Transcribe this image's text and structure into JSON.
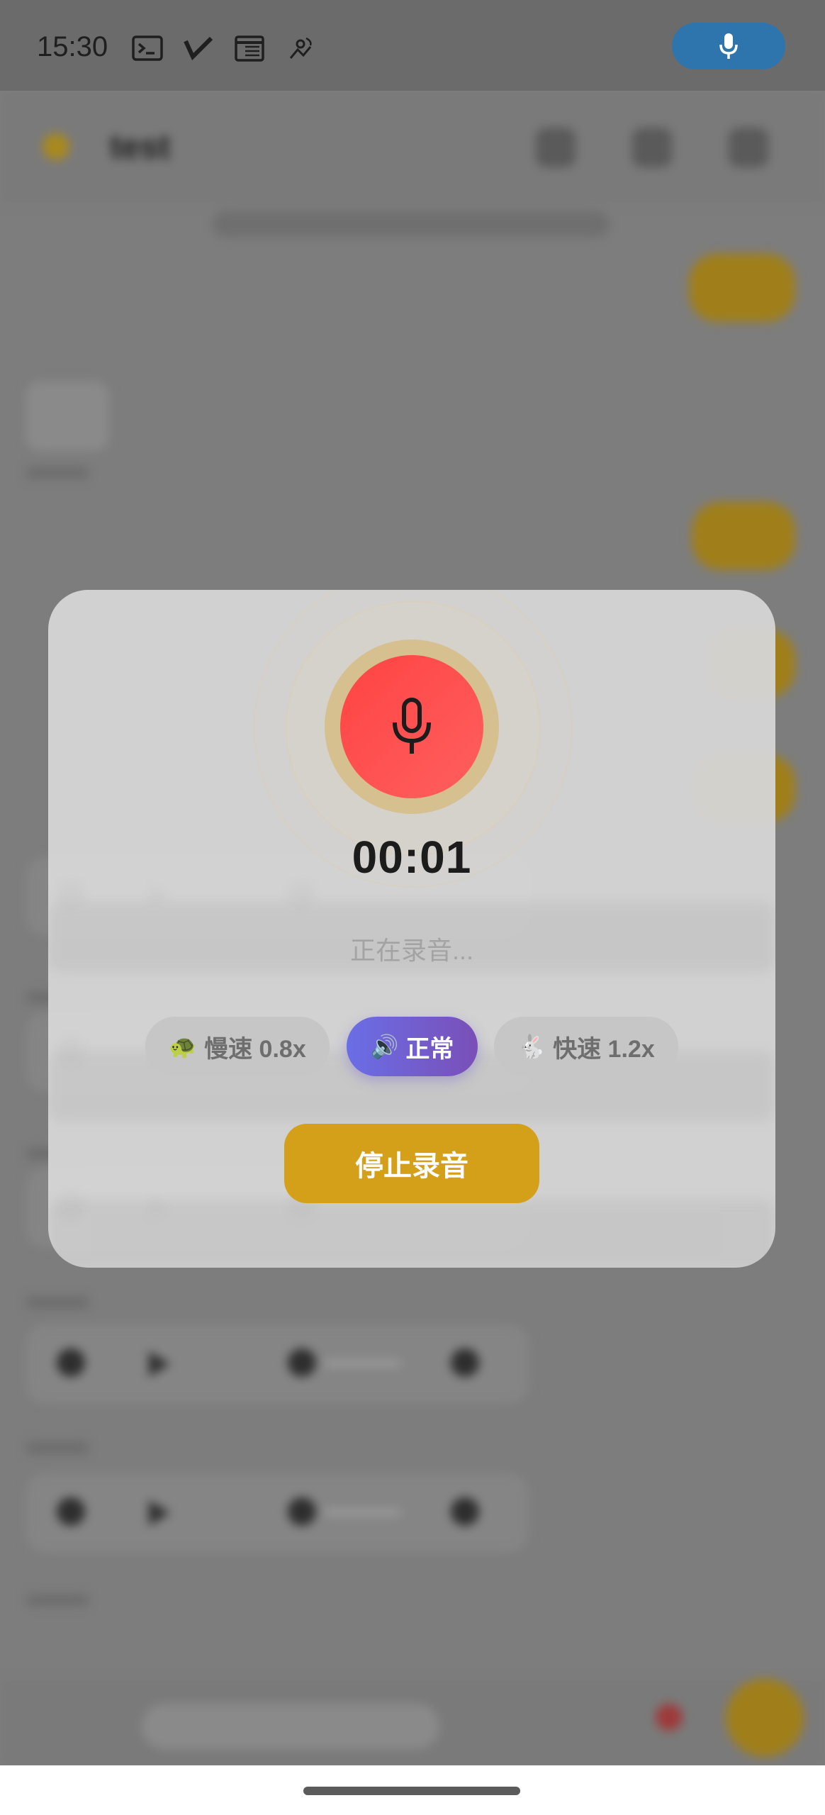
{
  "status_bar": {
    "time": "15:30",
    "icons": [
      "terminal-icon",
      "check-icon",
      "calendar-icon",
      "satellite-icon"
    ],
    "mic_indicator": "microphone-icon"
  },
  "background_app": {
    "title": "test",
    "notice": "",
    "bubbles": [
      "",
      "",
      "",
      ""
    ],
    "avatar_text": "",
    "voice_messages": [
      {
        "duration": "",
        "icon": "voice-icon"
      },
      {
        "duration": "",
        "icon": "voice-icon"
      },
      {
        "duration": "",
        "icon": "voice-icon"
      },
      {
        "duration": "",
        "icon": "voice-icon"
      },
      {
        "duration": "",
        "icon": "voice-icon"
      }
    ],
    "input_placeholder": ""
  },
  "recording_modal": {
    "mic_icon": "microphone-icon",
    "timer": "00:01",
    "status": "正在录音...",
    "speeds": [
      {
        "emoji": "🐢",
        "label": "慢速 0.8x",
        "selected": false
      },
      {
        "emoji": "🔊",
        "label": "正常",
        "selected": true
      },
      {
        "emoji": "🐇",
        "label": "快速 1.2x",
        "selected": false
      }
    ],
    "stop_label": "停止录音"
  },
  "colors": {
    "accent": "#d4a019",
    "record": "#ff4d4d",
    "speed_selected_start": "#6a6ee6",
    "speed_selected_end": "#7a4fb7",
    "status_pill": "#2f75ad"
  }
}
